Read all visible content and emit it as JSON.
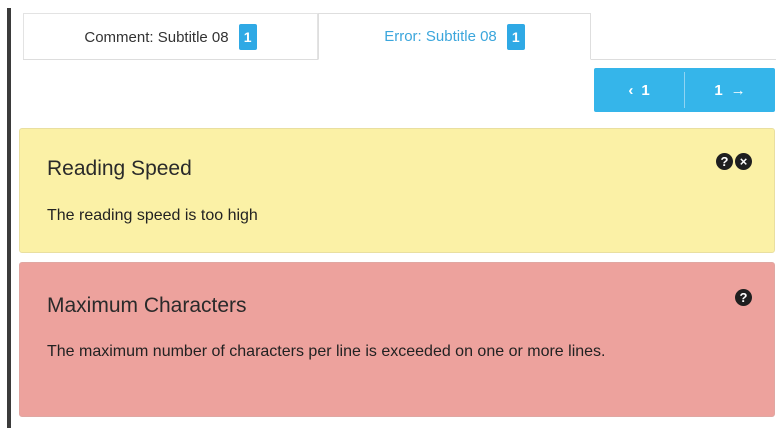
{
  "tabs": [
    {
      "label": "Comment: Subtitle 08",
      "count": "1"
    },
    {
      "label": "Error: Subtitle 08",
      "count": "1"
    }
  ],
  "pager": {
    "prev_icon": "chevron-left-icon",
    "prev_value": "1",
    "next_value": "1",
    "next_icon": "arrow-right-icon"
  },
  "issues": [
    {
      "title": "Reading Speed",
      "description": "The reading speed is too high",
      "color": "#fbf1a6",
      "icons": [
        "question-circle-icon",
        "close-circle-icon"
      ]
    },
    {
      "title": "Maximum Characters",
      "description": "The maximum number of characters per line is exceeded on one or more lines.",
      "color": "#eda29d",
      "icons": [
        "question-circle-icon"
      ]
    }
  ],
  "colors": {
    "accent": "#35b5ea",
    "active_tab_text": "#3ba6dc"
  }
}
